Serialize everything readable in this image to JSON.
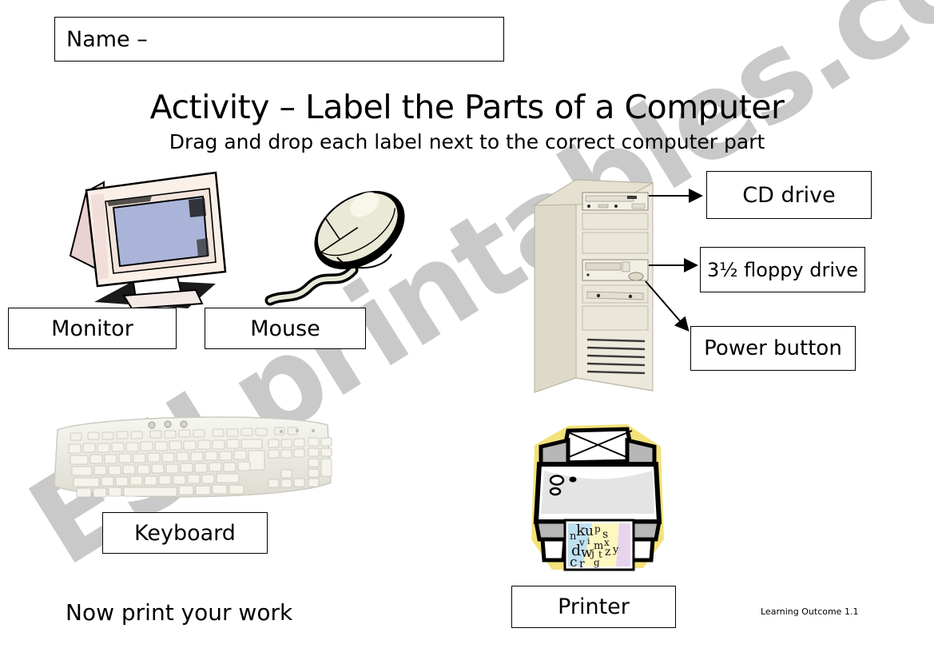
{
  "worksheet": {
    "name_field_label": "Name –",
    "title": "Activity – Label the Parts of a Computer",
    "subtitle": "Drag and drop each label next to the correct computer part",
    "footer_note": "Now print your work",
    "learning_outcome": "Learning Outcome 1.1",
    "watermark": "ESLprintables.com"
  },
  "labels": [
    {
      "id": "cd-drive",
      "text": "CD drive"
    },
    {
      "id": "floppy-drive",
      "text": "3½ floppy drive"
    },
    {
      "id": "power-button",
      "text": "Power button"
    },
    {
      "id": "monitor",
      "text": "Monitor"
    },
    {
      "id": "mouse",
      "text": "Mouse"
    },
    {
      "id": "keyboard",
      "text": "Keyboard"
    },
    {
      "id": "printer",
      "text": "Printer"
    }
  ],
  "artwork": [
    {
      "id": "monitor-image",
      "alt": "CRT monitor"
    },
    {
      "id": "mouse-image",
      "alt": "computer mouse"
    },
    {
      "id": "tower-image",
      "alt": "desktop tower case"
    },
    {
      "id": "keyboard-image",
      "alt": "keyboard"
    },
    {
      "id": "printer-image",
      "alt": "printer"
    }
  ],
  "printed_page_letters": "nkups vi mx dwj tzy cr g",
  "colors": {
    "ink": "#000000",
    "page_background": "#ffffff",
    "watermark": "#c9c9c9",
    "monitor_case": "#f6e7e2",
    "monitor_screen": "#aab4d8",
    "tower_case": "#e8e4d6",
    "keyboard_case": "#eeeee8",
    "printer_glow": "#f4e27a"
  }
}
